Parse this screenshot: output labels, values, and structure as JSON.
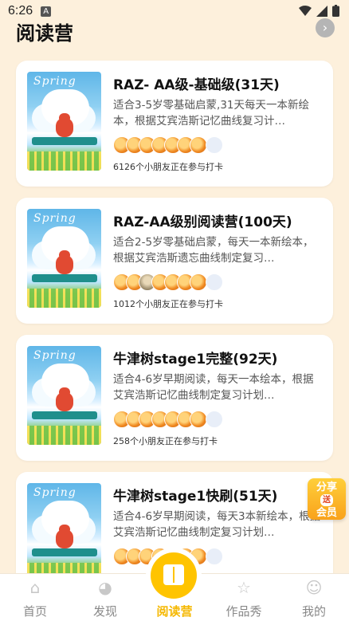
{
  "status_bar": {
    "time": "6:26",
    "notification_badge": "A"
  },
  "header": {
    "title": "阅读营",
    "more_icon": "chevron-right-icon"
  },
  "camps": [
    {
      "name": "RAZ- AA级-基础级(31天)",
      "desc": "适合3-5岁零基础启蒙,31天每天一本新绘本，根据艾宾浩斯记忆曲线复习计…",
      "cover_text": "Spring",
      "avatars": [
        "orange",
        "orange",
        "orange",
        "orange",
        "orange",
        "orange",
        "orange"
      ],
      "count": "6126个小朋友正在参与打卡"
    },
    {
      "name": "RAZ-AA级别阅读营(100天)",
      "desc": "适合2-5岁零基础启蒙，每天一本新绘本，根据艾宾浩斯遗忘曲线制定复习…",
      "cover_text": "Spring",
      "avatars": [
        "orange",
        "orange",
        "photo",
        "orange",
        "orange",
        "orange",
        "orange"
      ],
      "count": "1012个小朋友正在参与打卡"
    },
    {
      "name": "牛津树stage1完整(92天)",
      "desc": "适合4-6岁早期阅读，每天一本绘本，根据艾宾浩斯记忆曲线制定复习计划…",
      "cover_text": "Spring",
      "avatars": [
        "orange",
        "orange",
        "orange",
        "orange",
        "orange",
        "orange",
        "orange"
      ],
      "count": "258个小朋友正在参与打卡"
    },
    {
      "name": "牛津树stage1快刷(51天)",
      "desc": "适合4-6岁早期阅读，每天3本新绘本，根据艾宾浩斯记忆曲线制定复习计划…",
      "cover_text": "Spring",
      "avatars": [
        "orange",
        "orange",
        "orange",
        "orange",
        "orange",
        "orange",
        "orange"
      ],
      "count": ""
    }
  ],
  "share_badge": {
    "line1": "分享",
    "line2": "送",
    "line3": "会员"
  },
  "tabbar": {
    "tabs": [
      {
        "label": "首页",
        "icon": "home-icon"
      },
      {
        "label": "发现",
        "icon": "discover-icon"
      },
      {
        "label": "阅读营",
        "icon": "book-icon",
        "active": true
      },
      {
        "label": "作品秀",
        "icon": "star-icon"
      },
      {
        "label": "我的",
        "icon": "profile-icon"
      }
    ]
  },
  "colors": {
    "background": "#fdf0dc",
    "accent": "#ffc400",
    "active_tab": "#f5b800"
  }
}
